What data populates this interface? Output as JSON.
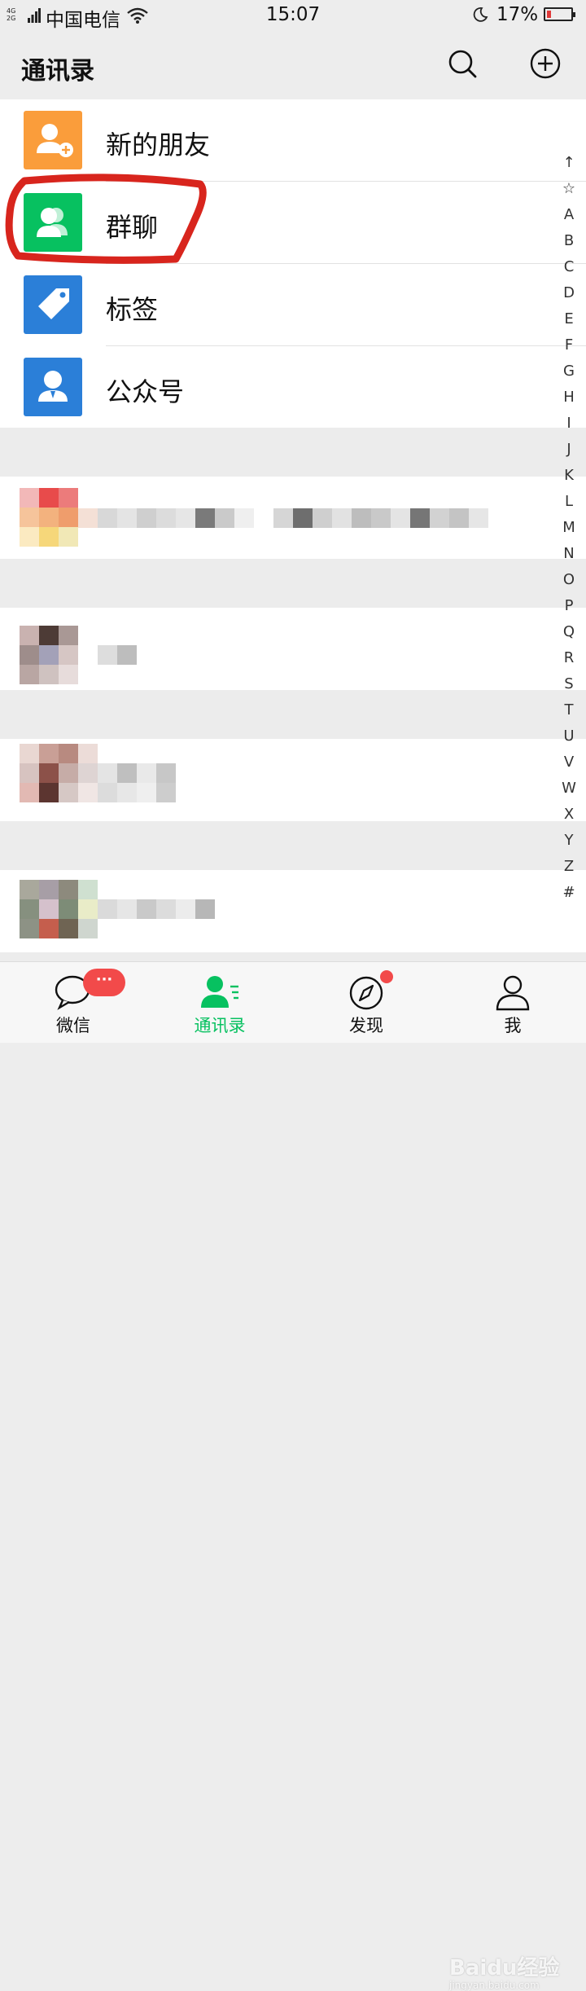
{
  "status_bar": {
    "network": [
      "4G",
      "2G"
    ],
    "carrier": "中国电信",
    "time": "15:07",
    "battery_percent": "17%",
    "battery_level": 0.17
  },
  "header": {
    "title": "通讯录",
    "search_icon": "search-icon",
    "add_icon": "plus-circle-icon"
  },
  "top_items": [
    {
      "label": "新的朋友",
      "icon": "add-friend-icon",
      "color": "#fa9d3b"
    },
    {
      "label": "群聊",
      "icon": "group-chat-icon",
      "color": "#07c160"
    },
    {
      "label": "标签",
      "icon": "tag-icon",
      "color": "#2b7fd8"
    },
    {
      "label": "公众号",
      "icon": "official-account-icon",
      "color": "#2b7fd8"
    }
  ],
  "index_letters": [
    "↑",
    "☆",
    "A",
    "B",
    "C",
    "D",
    "E",
    "F",
    "G",
    "H",
    "I",
    "J",
    "K",
    "L",
    "M",
    "N",
    "O",
    "P",
    "Q",
    "R",
    "S",
    "T",
    "U",
    "V",
    "W",
    "X",
    "Y",
    "Z",
    "#"
  ],
  "tabs": [
    {
      "label": "微信",
      "icon": "chat-bubble-icon",
      "badge": "···"
    },
    {
      "label": "通讯录",
      "icon": "contacts-icon",
      "active": true
    },
    {
      "label": "发现",
      "icon": "compass-icon",
      "dot": true
    },
    {
      "label": "我",
      "icon": "person-icon"
    }
  ],
  "accent_color": "#07c160",
  "annotation_color": "#d8251d",
  "watermark": {
    "text": "Baidu经验",
    "sub": "jingyan.baidu.com"
  }
}
